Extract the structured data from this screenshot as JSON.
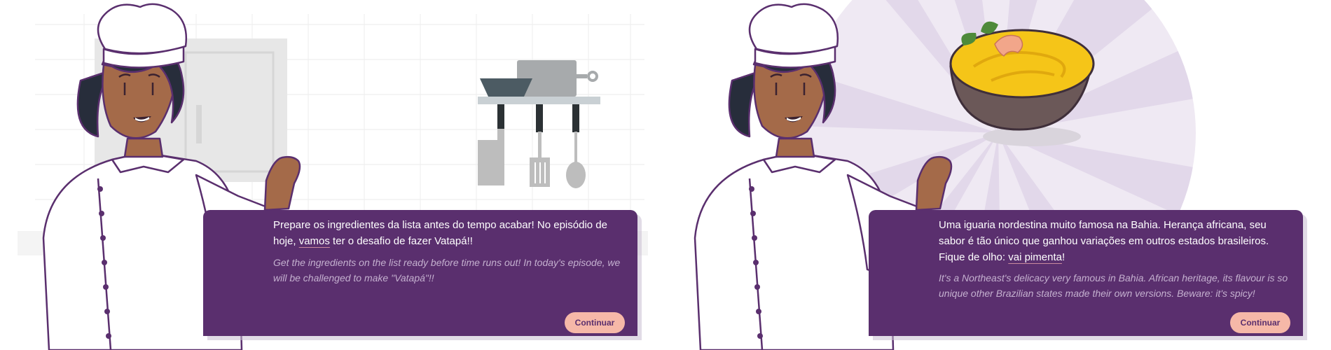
{
  "panels": [
    {
      "dialog": {
        "text_pt_before_link": "Prepare os ingredientes da lista antes do tempo acabar! No episódio de hoje, ",
        "text_pt_link": "vamos",
        "text_pt_after_link": " ter o desafio de fazer Vatapá!!",
        "text_en": "Get the ingredients on the list ready before time runs out! In today's episode, we will be challenged to make \"Vatapá\"!!",
        "button_label": "Continuar"
      },
      "icons": [
        "chef-character",
        "kitchen-fridge-icon",
        "pans-icon",
        "knife-icon",
        "spatula-icon",
        "ladle-icon"
      ]
    },
    {
      "dialog": {
        "text_pt_before_link": "Uma iguaria nordestina muito famosa na Bahia. Herança africana, seu sabor é tão único que ganhou variações em outros estados brasileiros. Fique de olho: ",
        "text_pt_link": "vai pimenta",
        "text_pt_after_link": "!",
        "text_en": "It's a Northeast's delicacy very famous in Bahia. African heritage, its flavour is so unique other Brazilian states made their own versions. Beware: it's spicy!",
        "button_label": "Continuar"
      },
      "icons": [
        "chef-character",
        "sunburst-background",
        "vatapa-bowl-icon"
      ]
    }
  ],
  "colors": {
    "dialog_bg": "#5a2f6e",
    "button_bg": "#f6b8a8",
    "vatapa_yellow": "#f5c518",
    "bowl_brown": "#6b5858"
  }
}
